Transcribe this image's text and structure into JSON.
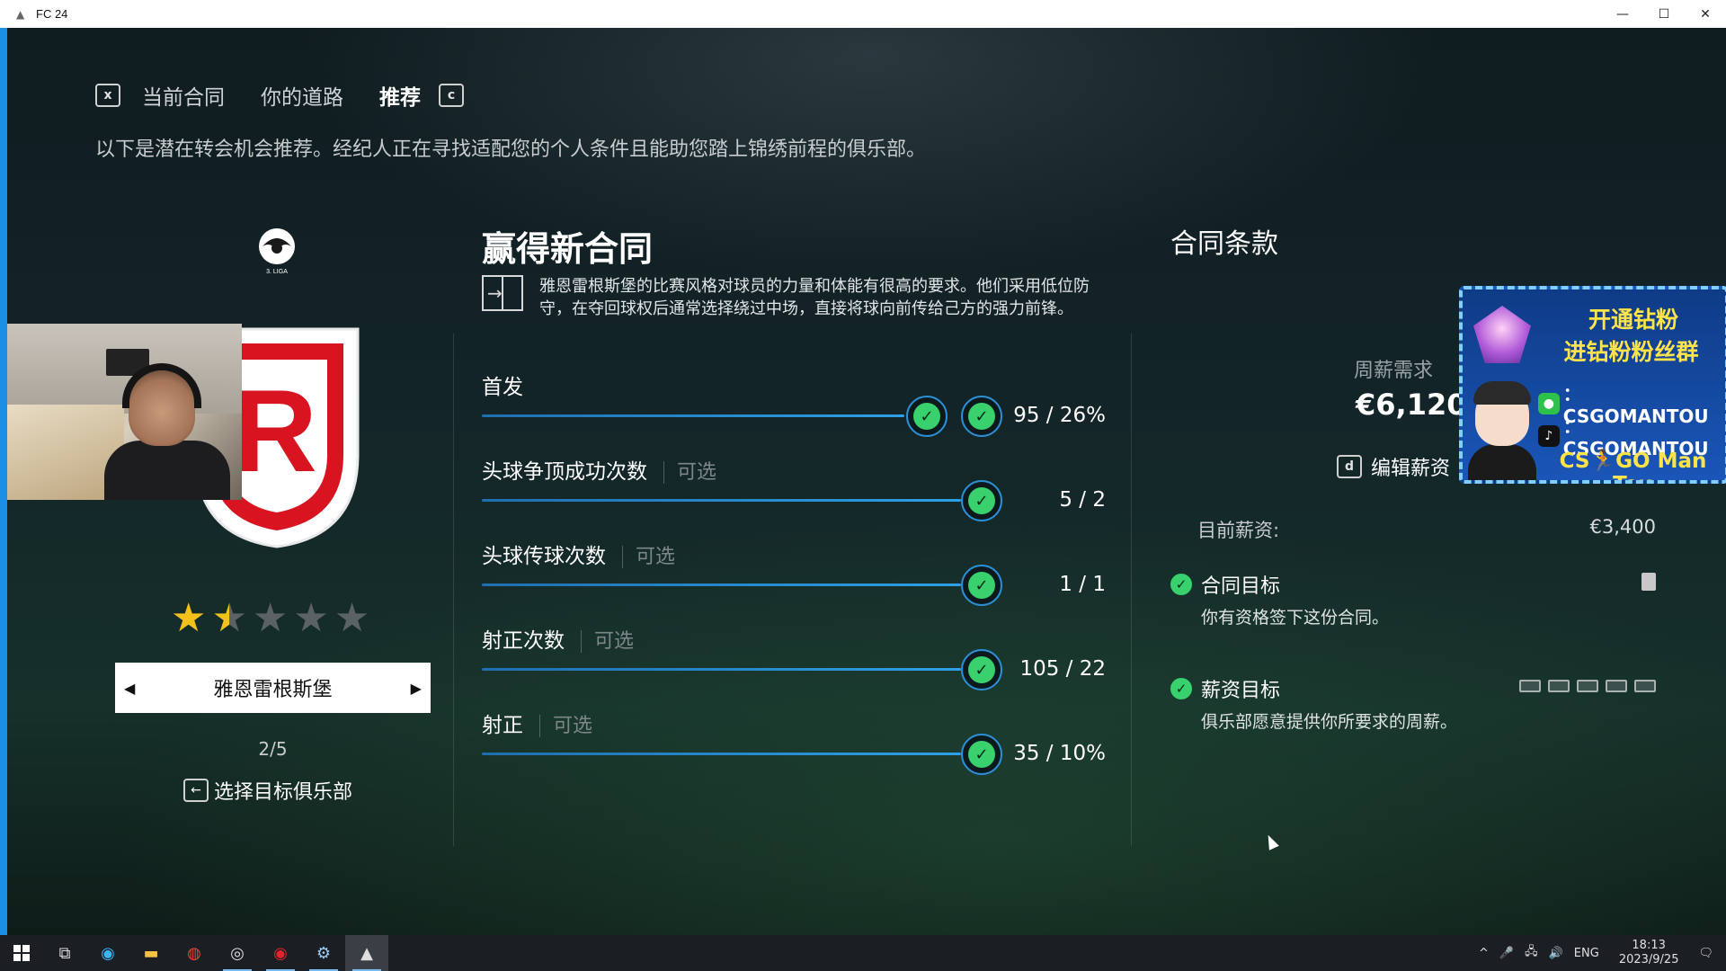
{
  "window": {
    "title": "FC 24",
    "minimize": "—",
    "maximize": "☐",
    "close": "✕"
  },
  "tabs": {
    "prev_key": "x",
    "next_key": "c",
    "items": [
      {
        "label": "当前合同",
        "active": false
      },
      {
        "label": "你的道路",
        "active": false
      },
      {
        "label": "推荐",
        "active": true
      }
    ]
  },
  "subtitle": "以下是潜在转会机会推荐。经纪人正在寻找适配您的个人条件且能助您踏上锦绣前程的俱乐部。",
  "club": {
    "rating_stars": 1.5,
    "max_stars": 5,
    "name": "雅恩雷根斯堡",
    "prev_arrow": "◀",
    "next_arrow": "▶",
    "count": "2/5",
    "select_key": "←",
    "select_label": "选择目标俱乐部",
    "league_logo_text": "3. LIGA",
    "crest_letter": "R",
    "crest_color": "#d7141f"
  },
  "goals": {
    "title": "赢得新合同",
    "description": "雅恩雷根斯堡的比赛风格对球员的力量和体能有很高的要求。他们采用低位防守，在夺回球权后通常选择绕过中场，直接将球向前传给己方的强力前锋。",
    "optional_label": "可选",
    "items": [
      {
        "label": "首发",
        "optional": false,
        "value": "95 / 26%"
      },
      {
        "label": "头球争顶成功次数",
        "optional": true,
        "value": "5 / 2"
      },
      {
        "label": "头球传球次数",
        "optional": true,
        "value": "1 / 1"
      },
      {
        "label": "射正次数",
        "optional": true,
        "value": "105 / 22"
      },
      {
        "label": "射正",
        "optional": true,
        "value": "35 / 10%"
      }
    ]
  },
  "contract": {
    "title": "合同条款",
    "weekly_wage_label": "周薪需求",
    "weekly_wage_value": "€6,120",
    "edit_key": "d",
    "edit_label": "编辑薪资",
    "current_wage_label": "目前薪资:",
    "current_wage_value": "€3,400",
    "objectives": [
      {
        "title": "合同目标",
        "desc": "你有资格签下这份合同。"
      },
      {
        "title": "薪资目标",
        "desc": "俱乐部愿意提供你所要求的周薪。"
      }
    ]
  },
  "promo": {
    "line1": "开通钻粉",
    "line2": "进钻粉粉丝群",
    "wechat": "：CSGOMANTOU",
    "tiktok": "：CSGOMANTOU",
    "footer": "CS🏃GO Man Tou"
  },
  "taskbar": {
    "tray_lang": "ENG",
    "time": "18:13",
    "date": "2023/9/25",
    "chevron": "^",
    "mic": "🎤",
    "network": "🖧",
    "volume": "🔊",
    "notifications": "🗨"
  }
}
